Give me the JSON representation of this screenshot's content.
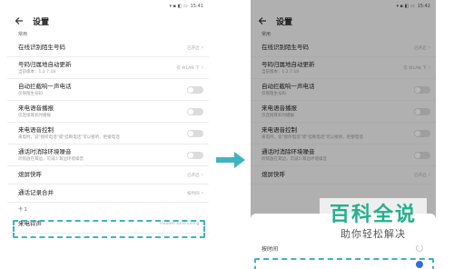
{
  "colors": {
    "accent_dashed": "#3fb3c0",
    "arrow": "#3fb3c0",
    "watermark_green": "#22b18c",
    "radio_selected": "#2f6fd8"
  },
  "left_screen": {
    "status_time": "15:41",
    "title": "设置",
    "section_common": "常用",
    "rows": [
      {
        "title": "在线识别陌生号码",
        "right": "已开启"
      },
      {
        "title": "号码归属地自动更新",
        "sub": "当前版本：1.2.7.18",
        "right": "仅 WLAN 下"
      },
      {
        "title": "自动拦截响一声电话",
        "sub": "仅限陌生号码"
      },
      {
        "title": "来电语音播报",
        "sub": "仅连接耳机时播报"
      },
      {
        "title": "来电语音控制",
        "sub": "来电时，说\"接听电话\"或\"挂断电话\"可以接听、拒接电话"
      },
      {
        "title": "通话时消除环境噪音",
        "sub": "听筒放在耳边，可减少耳边环境噪音"
      },
      {
        "title": "熄屏快呼",
        "right": "已开启"
      },
      {
        "title": "通话记录合并",
        "right": "按时间"
      }
    ],
    "section_card": "卡 1",
    "ringtone": {
      "title": "来电铃声",
      "right": "Huawei Tune Living"
    }
  },
  "right_screen": {
    "status_time": "15:42",
    "title": "设置",
    "section_common": "常用",
    "rows": [
      {
        "title": "在线识别陌生号码",
        "right": "已开启"
      },
      {
        "title": "号码归属地自动更新",
        "sub": "当前版本：1.2.7.18",
        "right": "仅 WLAN 下"
      },
      {
        "title": "自动拦截响一声电话",
        "sub": "仅限陌生号码"
      },
      {
        "title": "来电语音播报",
        "sub": "仅连接耳机时播报"
      },
      {
        "title": "来电语音控制",
        "sub": "来电时，说\"接听电话\"或\"挂断电话\"可以接听、拒接电话"
      },
      {
        "title": "通话时消除环境噪音",
        "sub": "听筒放在耳边，可减少耳边环境噪音"
      },
      {
        "title": "熄屏快呼",
        "right": "已开启"
      }
    ],
    "sheet_option_1": "按时间"
  },
  "watermark": {
    "main": "百科全说",
    "sub": "助你轻松解决"
  }
}
